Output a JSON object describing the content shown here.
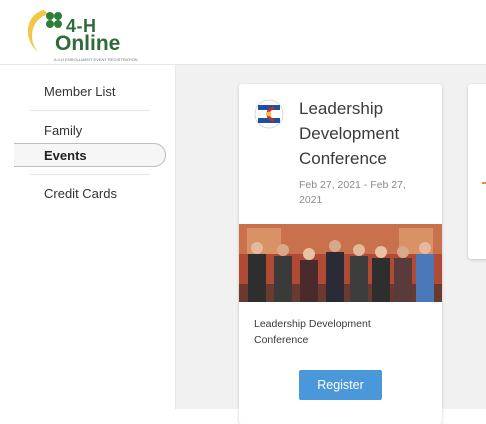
{
  "header": {
    "logo_line1": "4-H",
    "logo_line2": "Online",
    "logo_tagline": "A 4-H ENROLLMENT EVENT REGISTRATION"
  },
  "sidebar": {
    "items": [
      {
        "label": "Member List"
      },
      {
        "label": "Family"
      },
      {
        "label": "Events",
        "active": true
      },
      {
        "label": "Credit Cards"
      }
    ]
  },
  "main": {
    "event_card": {
      "title": "Leadership Development Conference",
      "dates": "Feb 27, 2021 - Feb 27, 2021",
      "name": "Leadership Development Conference",
      "register_label": "Register"
    }
  },
  "colors": {
    "brand_green": "#2f6b3a",
    "accent_blue": "#4a98d9",
    "background": "#f1f1f1"
  }
}
